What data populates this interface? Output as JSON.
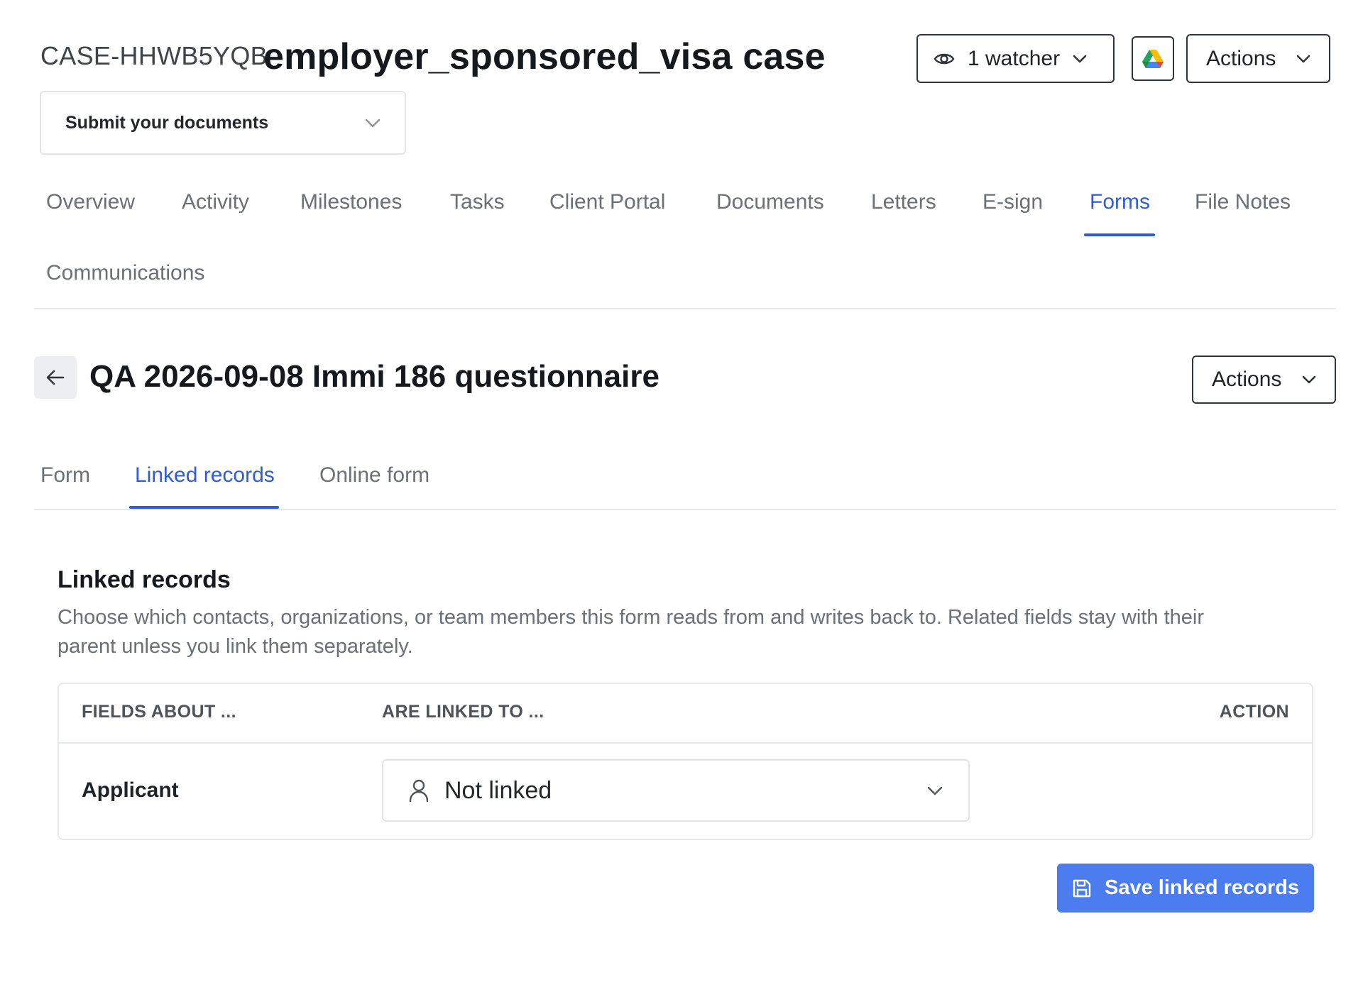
{
  "header": {
    "case_id": "CASE-HHWB5YQB",
    "case_title": "employer_sponsored_visa case",
    "watcher_label": "1 watcher",
    "watcher_icon": "eye-icon",
    "drive_icon": "google-drive-icon",
    "actions_label": "Actions"
  },
  "status_select": {
    "value": "Submit your documents"
  },
  "main_tabs": [
    {
      "label": "Overview"
    },
    {
      "label": "Activity"
    },
    {
      "label": "Milestones"
    },
    {
      "label": "Tasks"
    },
    {
      "label": "Client Portal"
    },
    {
      "label": "Documents"
    },
    {
      "label": "Letters"
    },
    {
      "label": "E-sign"
    },
    {
      "label": "Forms",
      "active": true
    },
    {
      "label": "File Notes"
    },
    {
      "label": "Communications"
    }
  ],
  "form": {
    "title": "QA 2026-09-08 Immi 186 questionnaire",
    "actions_label": "Actions",
    "tabs": [
      {
        "label": "Form"
      },
      {
        "label": "Linked records",
        "active": true
      },
      {
        "label": "Online form"
      }
    ]
  },
  "linked_records": {
    "title": "Linked records",
    "description": "Choose which contacts, organizations, or team members this form reads from and writes back to. Related fields stay with their parent unless you link them separately.",
    "table": {
      "headers": [
        "FIELDS ABOUT ...",
        "ARE LINKED TO ...",
        "ACTION"
      ],
      "rows": [
        {
          "field": "Applicant",
          "linked_to": "Not linked"
        }
      ]
    },
    "save_label": "Save linked records"
  },
  "colors": {
    "accent": "#2f5bd8",
    "primary_button": "#4b7cf0",
    "muted_text": "#6a7076",
    "border": "#e6e8eb"
  }
}
